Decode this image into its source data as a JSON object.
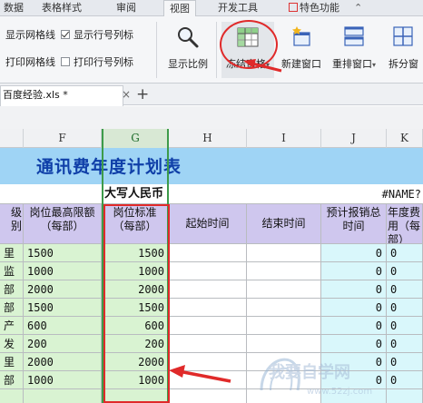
{
  "ribbon_tabs": [
    {
      "label": "数据",
      "active": false
    },
    {
      "label": "表格样式",
      "active": false
    },
    {
      "label": "审阅",
      "active": false
    },
    {
      "label": "视图",
      "active": true
    },
    {
      "label": "开发工具",
      "active": false
    },
    {
      "label": "特色功能",
      "active": false
    }
  ],
  "ribbon": {
    "checkboxes": [
      {
        "label": "显示网格线",
        "checked": true
      },
      {
        "label": "显示行号列标",
        "checked": true
      },
      {
        "label": "打印网格线",
        "checked": false
      },
      {
        "label": "打印行号列标",
        "checked": false
      }
    ],
    "buttons": {
      "zoom": "显示比例",
      "freeze": "冻结窗格",
      "new_window": "新建窗口",
      "arrange": "重排窗口",
      "split": "拆分窗"
    }
  },
  "doc_tab": {
    "name": "百度经验.xls *",
    "close": "×",
    "add": "+"
  },
  "columns": [
    "F",
    "G",
    "H",
    "I",
    "J",
    "K"
  ],
  "sheet": {
    "title": "通讯费年度计划表",
    "subheader_g": "大写人民币",
    "subheader_right": "#NAME?",
    "headers": {
      "e": "级别",
      "f": "岗位最高限额（每部）",
      "g": "岗位标准（每部）",
      "h": "起始时间",
      "i": "结束时间",
      "j": "预计报销总时间",
      "k": "年度费用（每部）"
    },
    "rows": [
      {
        "e": "里",
        "f": "1500",
        "g": "1500",
        "j": "0",
        "k": "0"
      },
      {
        "e": "监",
        "f": "1000",
        "g": "1000",
        "j": "0",
        "k": "0"
      },
      {
        "e": "部",
        "f": "2000",
        "g": "2000",
        "j": "0",
        "k": "0"
      },
      {
        "e": "部",
        "f": "1500",
        "g": "1500",
        "j": "0",
        "k": "0"
      },
      {
        "e": "产",
        "f": "600",
        "g": "600",
        "j": "0",
        "k": "0"
      },
      {
        "e": "发",
        "f": "200",
        "g": "200",
        "j": "0",
        "k": "0"
      },
      {
        "e": "里",
        "f": "2000",
        "g": "2000",
        "j": "0",
        "k": "0"
      },
      {
        "e": "部",
        "f": "1000",
        "g": "1000",
        "j": "0",
        "k": "0"
      },
      {
        "e": "",
        "f": "",
        "g": "",
        "j": "",
        "k": ""
      }
    ]
  },
  "watermark": {
    "line1": "我要自学网",
    "line2": "www.52zj.com"
  },
  "colors": {
    "title_band": "#9fd4f5",
    "title_text": "#0f3fa8",
    "annotation_red": "#e02a2a",
    "freeze_green": "#3d9b4a",
    "header_purple": "#cfc7ee",
    "col_green": "#d9f3d2",
    "col_cyan": "#d9f7fb"
  }
}
